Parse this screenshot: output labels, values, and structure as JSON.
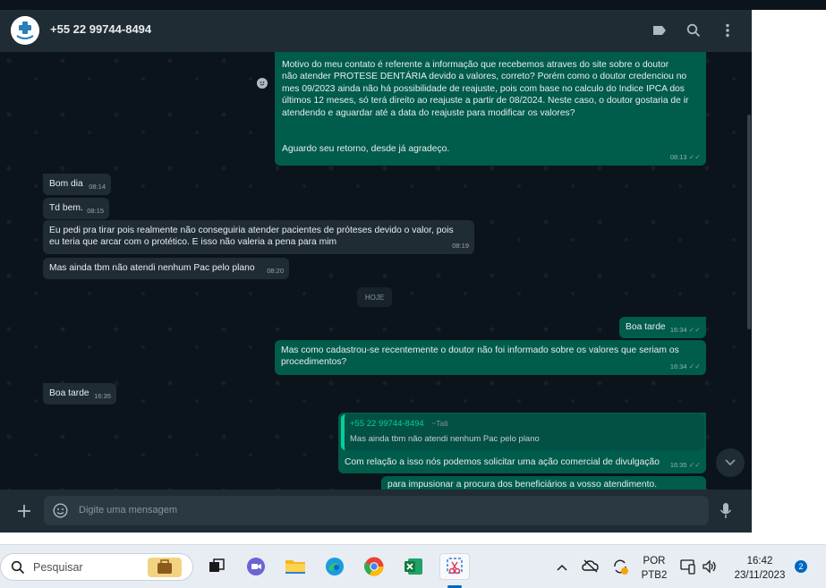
{
  "header": {
    "contact_name": "+55 22 99744-8494",
    "icons": [
      "label-icon",
      "search-icon",
      "menu-icon"
    ]
  },
  "messages": [
    {
      "direction": "out",
      "text": "Motivo do meu contato é referente a informação que recebemos atraves do site sobre o doutor\nnão atender PROTESE DENTÁRIA devido a valores, correto? Porém como o doutor credenciou no\nmes 09/2023 ainda não há possibilidade de reajuste, pois com base no calculo do Indice IPCA dos\núltimos 12 meses, só terá direito ao reajuste a partir de 08/2024. Neste caso, o doutor gostaria de ir\natendendo e aguardar até a data do reajuste para modificar os valores?\n\n\nAguardo seu retorno, desde já agradeço.",
      "time": "08:13"
    },
    {
      "direction": "in",
      "text": "Bom dia",
      "time": "08:14"
    },
    {
      "direction": "in",
      "text": "Td bem.",
      "time": "08:15"
    },
    {
      "direction": "in",
      "text": "Eu pedi pra tirar pois realmente não conseguiria atender pacientes de próteses devido o valor, pois\neu teria que arcar com o protético. E isso não valeria a pena para mim",
      "time": "08:19"
    },
    {
      "direction": "in",
      "text": "Mas ainda tbm não atendi nenhum Pac pelo plano",
      "time": "08:20"
    },
    {
      "direction": "out",
      "text": "Boa tarde",
      "time": "16:34"
    },
    {
      "direction": "out",
      "text": "Mas como cadastrou-se recentemente o doutor não foi informado sobre os valores que seriam os\nprocedimentos?",
      "time": "16:34"
    },
    {
      "direction": "in",
      "text": "Boa tarde",
      "time": "16:35"
    },
    {
      "direction": "out",
      "text": "Com relação a isso nós podemos solicitar uma ação comercial de divulgação",
      "time": "16:35"
    },
    {
      "direction": "out",
      "text": "para impusionar a procura dos beneficiários a vosso atendimento.",
      "time": ""
    }
  ],
  "date_divider": "HOJE",
  "quote": {
    "author": "+55 22 99744-8494",
    "author_alias": "~Tati",
    "text": "Mas ainda tbm não atendi nenhum Pac pelo plano"
  },
  "footer": {
    "placeholder": "Digite uma mensagem"
  },
  "taskbar": {
    "search_label": "Pesquisar",
    "language": "POR",
    "layout": "PTB2",
    "time": "16:42",
    "date": "23/11/2023",
    "notification_count": "2"
  },
  "colors": {
    "incoming_bubble": "#202c33",
    "outgoing_bubble": "#005c4b",
    "accent": "#06cf9c"
  }
}
